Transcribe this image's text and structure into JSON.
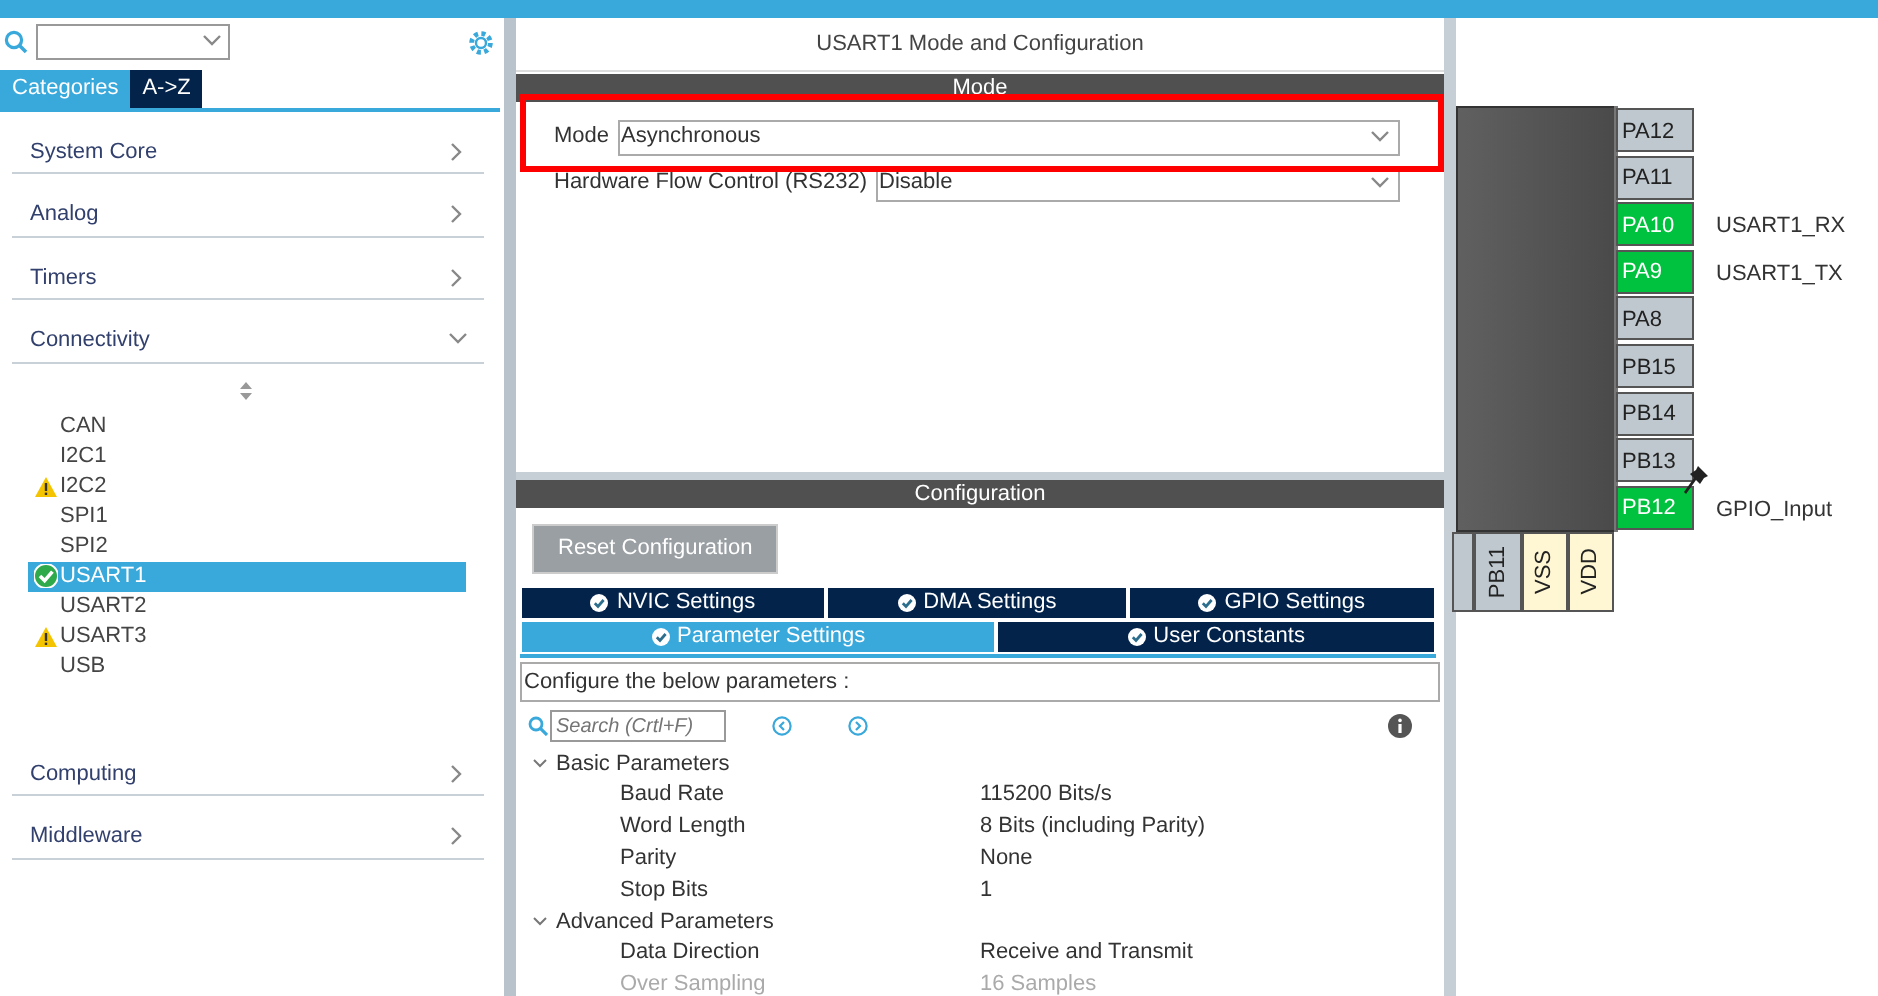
{
  "sidebar": {
    "tabs": [
      {
        "label": "Categories",
        "selected": true
      },
      {
        "label": "A->Z",
        "selected": false
      }
    ],
    "categories": [
      {
        "label": "System Core",
        "expanded": false
      },
      {
        "label": "Analog",
        "expanded": false
      },
      {
        "label": "Timers",
        "expanded": false
      },
      {
        "label": "Connectivity",
        "expanded": true,
        "children": [
          {
            "label": "CAN",
            "kind": "plain",
            "selected": false
          },
          {
            "label": "I2C1",
            "kind": "plain",
            "selected": false
          },
          {
            "label": "I2C2",
            "kind": "warning",
            "selected": false
          },
          {
            "label": "SPI1",
            "kind": "plain",
            "selected": false
          },
          {
            "label": "SPI2",
            "kind": "plain",
            "selected": false
          },
          {
            "label": "USART1",
            "kind": "ok",
            "selected": true
          },
          {
            "label": "USART2",
            "kind": "plain",
            "selected": false
          },
          {
            "label": "USART3",
            "kind": "warning",
            "selected": false
          },
          {
            "label": "USB",
            "kind": "plain",
            "selected": false
          }
        ]
      },
      {
        "label": "Computing",
        "expanded": false
      },
      {
        "label": "Middleware",
        "expanded": false
      }
    ]
  },
  "panel": {
    "title": "USART1 Mode and Configuration",
    "mode_header": "Mode",
    "mode_fields": [
      {
        "label": "Mode",
        "value": "Asynchronous"
      },
      {
        "label": "Hardware Flow Control (RS232)",
        "value": "Disable"
      }
    ],
    "config_header": "Configuration",
    "reset_button": "Reset Configuration",
    "tabs": [
      [
        {
          "label": "NVIC Settings",
          "selected": false
        },
        {
          "label": "DMA Settings",
          "selected": false
        },
        {
          "label": "GPIO Settings",
          "selected": false
        }
      ],
      [
        {
          "label": "Parameter Settings",
          "selected": true
        },
        {
          "label": "User Constants",
          "selected": false
        }
      ]
    ],
    "description": "Configure the below parameters :",
    "search": {
      "placeholder": "Search (Crtl+F)"
    },
    "groups": [
      {
        "label": "Basic Parameters",
        "expanded": true,
        "params": [
          {
            "name": "Baud Rate",
            "value": "115200 Bits/s",
            "disabled": false
          },
          {
            "name": "Word Length",
            "value": "8 Bits (including Parity)",
            "disabled": false
          },
          {
            "name": "Parity",
            "value": "None",
            "disabled": false
          },
          {
            "name": "Stop Bits",
            "value": "1",
            "disabled": false
          }
        ]
      },
      {
        "label": "Advanced Parameters",
        "expanded": true,
        "params": [
          {
            "name": "Data Direction",
            "value": "Receive and Transmit",
            "disabled": false
          },
          {
            "name": "Over Sampling",
            "value": "16 Samples",
            "disabled": true
          }
        ]
      }
    ]
  },
  "pinout": {
    "right_pins": [
      {
        "label": "PA12",
        "kind": "free"
      },
      {
        "label": "PA11",
        "kind": "free"
      },
      {
        "label": "PA10",
        "kind": "assigned",
        "signal": "USART1_RX"
      },
      {
        "label": "PA9",
        "kind": "assigned",
        "signal": "USART1_TX"
      },
      {
        "label": "PA8",
        "kind": "free"
      },
      {
        "label": "PB15",
        "kind": "free"
      },
      {
        "label": "PB14",
        "kind": "free"
      },
      {
        "label": "PB13",
        "kind": "free"
      },
      {
        "label": "PB12",
        "kind": "assigned",
        "signal": "GPIO_Input",
        "pinned": true
      }
    ],
    "bottom_pins": [
      {
        "kind": "free"
      },
      {
        "label": "PB11",
        "kind": "free"
      },
      {
        "label": "VSS",
        "kind": "power"
      },
      {
        "label": "VDD",
        "kind": "power"
      }
    ]
  }
}
